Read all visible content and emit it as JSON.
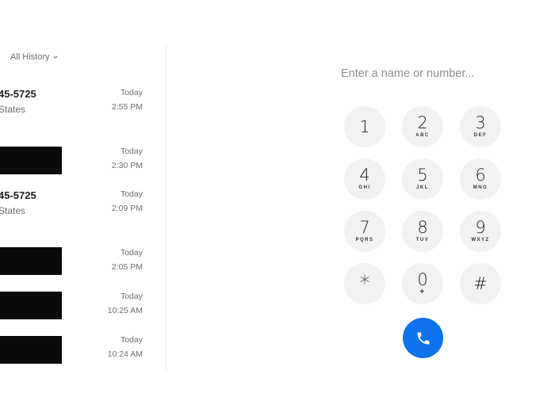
{
  "history": {
    "filter_label": "All History",
    "entries": [
      {
        "name": "45-5725",
        "subtitle": "States",
        "redacted": false,
        "day": "Today",
        "time": "2:55 PM"
      },
      {
        "name": "",
        "subtitle": "",
        "redacted": true,
        "day": "Today",
        "time": "2:30 PM"
      },
      {
        "name": "45-5725",
        "subtitle": "States",
        "redacted": false,
        "day": "Today",
        "time": "2:09 PM"
      },
      {
        "name": "",
        "subtitle": "",
        "redacted": true,
        "day": "Today",
        "time": "2:05 PM"
      },
      {
        "name": "",
        "subtitle": "",
        "redacted": true,
        "day": "Today",
        "time": "10:25 AM"
      },
      {
        "name": "",
        "subtitle": "",
        "redacted": true,
        "day": "Today",
        "time": "10:24 AM"
      }
    ]
  },
  "dialer": {
    "input_value": "",
    "input_placeholder": "Enter a name or number...",
    "keys": [
      {
        "digit": "1",
        "letters": ""
      },
      {
        "digit": "2",
        "letters": "ABC"
      },
      {
        "digit": "3",
        "letters": "DEF"
      },
      {
        "digit": "4",
        "letters": "GHI"
      },
      {
        "digit": "5",
        "letters": "JKL"
      },
      {
        "digit": "6",
        "letters": "MNO"
      },
      {
        "digit": "7",
        "letters": "PQRS"
      },
      {
        "digit": "8",
        "letters": "TUV"
      },
      {
        "digit": "9",
        "letters": "WXYZ"
      },
      {
        "digit": "*",
        "letters": ""
      },
      {
        "digit": "0",
        "letters": "+"
      },
      {
        "digit": "#",
        "letters": ""
      }
    ],
    "call_icon": "phone-icon",
    "call_color": "#0e72ed"
  }
}
